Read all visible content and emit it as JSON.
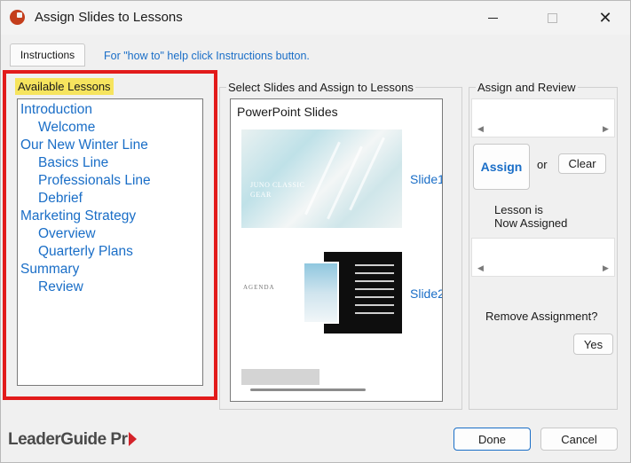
{
  "window": {
    "title": "Assign Slides to Lessons",
    "app_icon": "powerpoint-icon",
    "controls": {
      "minimize": "minimize-icon",
      "maximize": "maximize-icon",
      "close": "✕"
    }
  },
  "toolbar": {
    "instructions_tab": "Instructions",
    "help_text": "For \"how to\" help click Instructions button."
  },
  "lessons": {
    "label": "Available Lessons",
    "highlight_color": "#f6e45e",
    "frame_color": "#e21b1b",
    "items": [
      {
        "label": "Introduction",
        "level": 0
      },
      {
        "label": "Welcome",
        "level": 1
      },
      {
        "label": "Our New Winter Line",
        "level": 0
      },
      {
        "label": "Basics Line",
        "level": 1
      },
      {
        "label": "Professionals Line",
        "level": 1
      },
      {
        "label": "Debrief",
        "level": 1
      },
      {
        "label": "Marketing Strategy",
        "level": 0
      },
      {
        "label": "Overview",
        "level": 1
      },
      {
        "label": "Quarterly Plans",
        "level": 1
      },
      {
        "label": "Summary",
        "level": 0
      },
      {
        "label": "Review",
        "level": 1
      }
    ]
  },
  "slides": {
    "label": "Select Slides and Assign to Lessons",
    "panel_title": "PowerPoint Slides",
    "items": [
      {
        "caption_line1": "JUNO CLASSIC",
        "caption_line2": "GEAR",
        "link": "Slide1"
      },
      {
        "caption_line1": "AGENDA",
        "link": "Slide2"
      }
    ]
  },
  "assign": {
    "label": "Assign and Review",
    "assign_button": "Assign",
    "or_text": "or",
    "clear_button": "Clear",
    "status_line1": "Lesson is",
    "status_line2": "Now Assigned",
    "remove_question": "Remove Assignment?",
    "yes_button": "Yes"
  },
  "footer": {
    "logo_text": "LeaderGuide Pr",
    "done_button": "Done",
    "cancel_button": "Cancel",
    "accent_color": "#1a6ec7"
  }
}
